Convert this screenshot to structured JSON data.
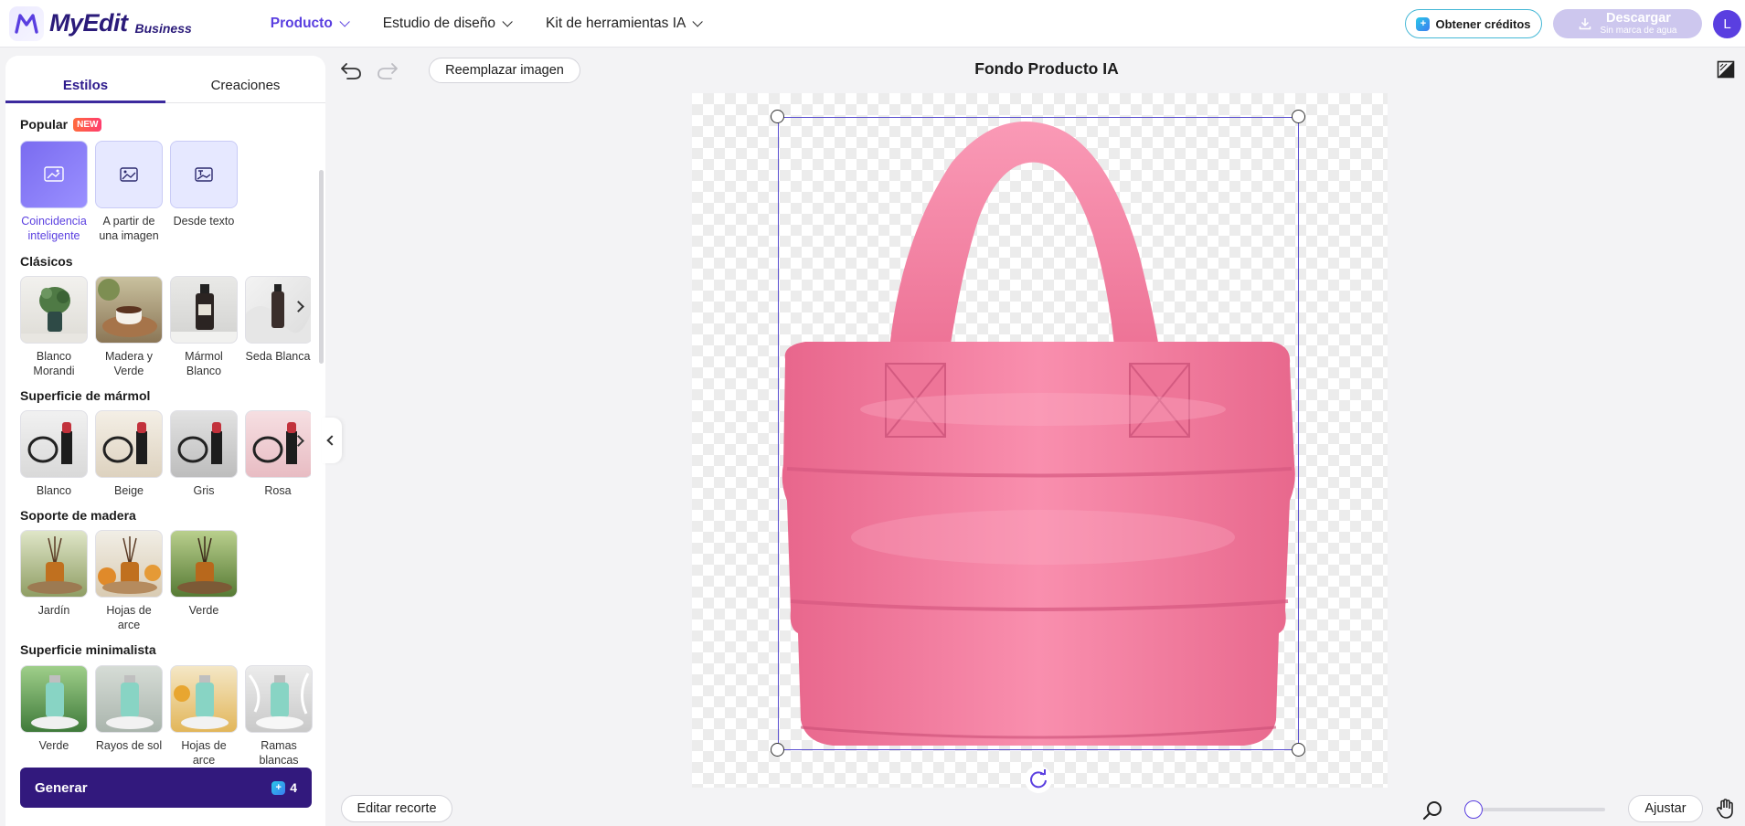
{
  "brand": {
    "name": "MyEdit",
    "tier": "Business"
  },
  "nav": [
    {
      "label": "Producto",
      "active": true
    },
    {
      "label": "Estudio de diseño",
      "active": false
    },
    {
      "label": "Kit de herramientas IA",
      "active": false
    }
  ],
  "header": {
    "credits_label": "Obtener créditos",
    "download_label": "Descargar",
    "download_sub": "Sin marca de agua",
    "avatar_initial": "L"
  },
  "panel": {
    "tabs": [
      "Estilos",
      "Creaciones"
    ],
    "active_tab": "Estilos",
    "popular": {
      "title": "Popular",
      "badge": "NEW",
      "items": [
        "Coincidencia inteligente",
        "A partir de una imagen",
        "Desde texto"
      ],
      "selected": "Coincidencia inteligente"
    },
    "clasicos": {
      "title": "Clásicos",
      "items": [
        "Blanco Morandi",
        "Madera y Verde",
        "Mármol Blanco",
        "Seda Blanca"
      ]
    },
    "marmol": {
      "title": "Superficie de mármol",
      "items": [
        "Blanco",
        "Beige",
        "Gris",
        "Rosa"
      ]
    },
    "madera": {
      "title": "Soporte de madera",
      "items": [
        "Jardín",
        "Hojas de arce",
        "Verde"
      ]
    },
    "minimalista": {
      "title": "Superficie minimalista",
      "items": [
        "Verde",
        "Rayos de sol",
        "Hojas de arce",
        "Ramas blancas"
      ]
    },
    "generate": {
      "label": "Generar",
      "cost": "4"
    }
  },
  "toolbar": {
    "replace_label": "Reemplazar imagen",
    "title": "Fondo Producto IA"
  },
  "bottom": {
    "edit_crop_label": "Editar recorte",
    "fit_label": "Ajustar",
    "zoom_fraction": 0.0
  },
  "colors": {
    "accent": "#5a3fe0",
    "generate_bg": "#32197d",
    "product": "#f47a9e",
    "credits_border": "#45b8d6"
  },
  "icons": [
    "undo-icon",
    "redo-icon",
    "compare-icon",
    "zoom-icon",
    "hand-icon",
    "rotate-icon"
  ]
}
